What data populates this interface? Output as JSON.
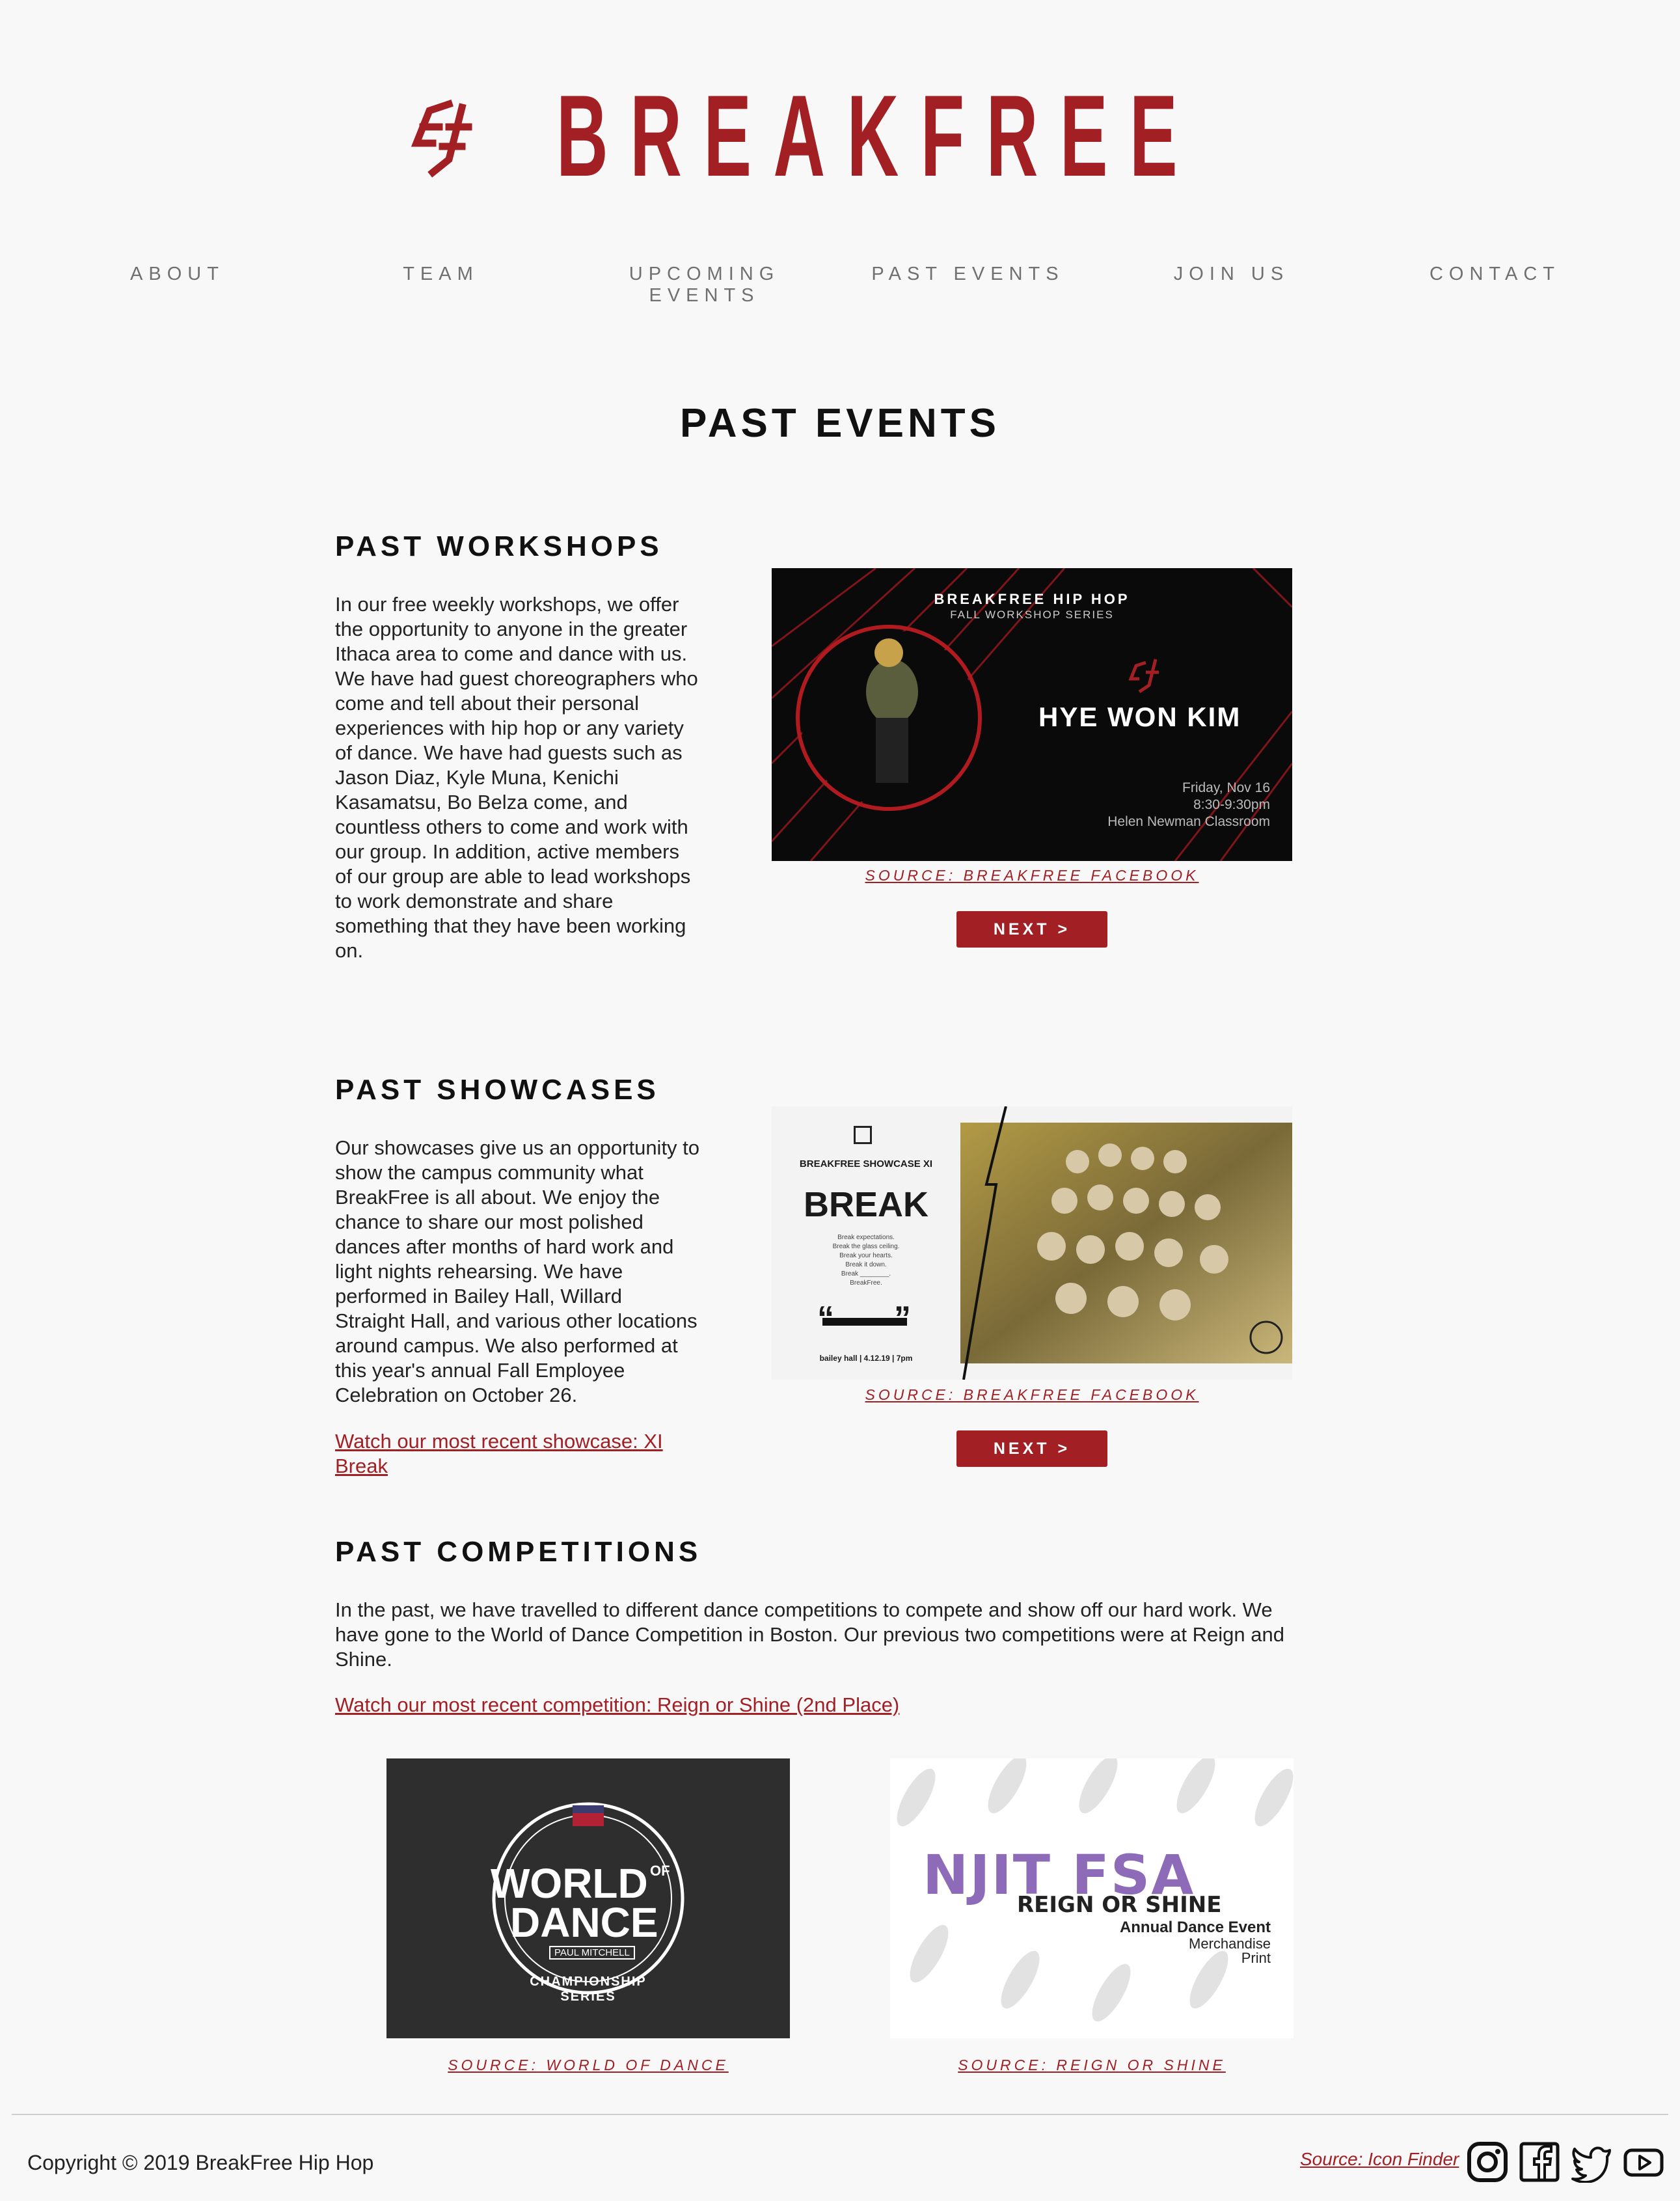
{
  "brand": {
    "name": "BREAKFREE",
    "color": "#a21f24",
    "logo_icon": "breakfree-logo-icon"
  },
  "nav": {
    "items": [
      {
        "label": "ABOUT"
      },
      {
        "label": "TEAM"
      },
      {
        "label": "UPCOMING EVENTS"
      },
      {
        "label": "PAST EVENTS"
      },
      {
        "label": "JOIN US"
      },
      {
        "label": "CONTACT"
      }
    ]
  },
  "page_title": "PAST EVENTS",
  "workshops": {
    "heading": "PAST WORKSHOPS",
    "text_lines": [
      "In our free weekly workshops, we offer",
      "the opportunity to anyone in the greater",
      "Ithaca area to come and dance with us.",
      "We have had guest choreographers who",
      "come and tell about their personal",
      "experiences with hip hop or any variety",
      "of dance. We have had guests such as",
      "Jason Diaz, Kyle Muna, Kenichi",
      "Kasamatsu, Bo Belza come, and",
      "countless others to come and work with",
      "our group. In addition, active members",
      "of our group are able to lead workshops",
      "to work demonstrate and share",
      "something that they have been working",
      "on."
    ],
    "poster": {
      "title": "BREAKFREE HIP HOP",
      "subtitle": "FALL WORKSHOP SERIES",
      "name": "HYE WON KIM",
      "date": "Friday, Nov 16",
      "time": "8:30-9:30pm",
      "place": "Helen Newman Classroom"
    },
    "source": "SOURCE: BREAKFREE FACEBOOK",
    "next": "NEXT >"
  },
  "showcases": {
    "heading": "PAST SHOWCASES",
    "text_lines": [
      "Our showcases give us an opportunity to",
      "show the campus community what",
      "BreakFree is all about. We enjoy the",
      "chance to share our most polished",
      "dances after months of hard work and",
      "light nights rehearsing. We have",
      "performed in Bailey Hall, Willard",
      "Straight Hall, and various other locations",
      "around campus. We also performed at",
      "this year's annual Fall Employee",
      "Celebration on October 26."
    ],
    "link_lines": [
      "Watch our most recent showcase: XI",
      "Break"
    ],
    "poster": {
      "title": "BREAKFREE SHOWCASE XI",
      "word": "BREAK",
      "lines": [
        "Break expectations.",
        "Break the glass ceiling.",
        "Break your hearts.",
        "Break it down.",
        "Break ________.",
        "BreakFree."
      ],
      "footer": "bailey hall | 4.12.19 | 7pm"
    },
    "source": "SOURCE: BREAKFREE FACEBOOK",
    "next": "NEXT >"
  },
  "competitions": {
    "heading": "PAST COMPETITIONS",
    "text_lines": [
      "In the past, we have travelled to different dance competitions to compete and show off our hard work. We",
      "have gone to the World of Dance Competition in Boston. Our previous two competitions were at Reign and",
      "Shine."
    ],
    "link": "Watch our most recent competition: Reign or Shine (2nd Place)",
    "wod": {
      "line1": "WORLD",
      "of": "OF",
      "line2": "DANCE",
      "sponsor": "PAUL MITCHELL",
      "series": "CHAMPIONSHIP SERIES"
    },
    "wod_source": "SOURCE: WORLD OF DANCE",
    "ros": {
      "title": "NJIT FSA",
      "subtitle": "REIGN OR SHINE",
      "line1": "Annual Dance Event",
      "line2": "Merchandise",
      "line3": "Print"
    },
    "ros_source": "SOURCE: REIGN OR SHINE"
  },
  "footer": {
    "copyright": "Copyright © 2019 BreakFree Hip Hop",
    "source": "Source: Icon Finder",
    "social": [
      "instagram-icon",
      "facebook-icon",
      "twitter-icon",
      "youtube-icon"
    ]
  }
}
